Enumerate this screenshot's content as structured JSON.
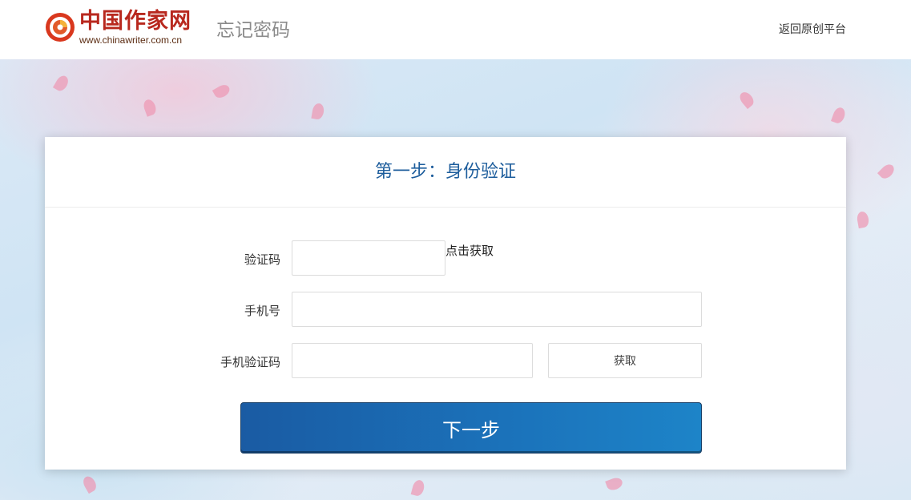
{
  "header": {
    "logo_text": "中国作家网",
    "logo_url": "www.chinawriter.com.cn",
    "page_heading": "忘记密码",
    "return_link": "返回原创平台"
  },
  "card": {
    "title": "第一步：身份验证",
    "fields": {
      "captcha": {
        "label": "验证码",
        "value": "",
        "get_link": "点击获取"
      },
      "phone": {
        "label": "手机号",
        "value": ""
      },
      "sms_code": {
        "label": "手机验证码",
        "value": "",
        "button_label": "获取"
      }
    },
    "next_button": "下一步"
  },
  "colors": {
    "title_blue": "#1d5d9c",
    "button_blue": "#1a5ba3",
    "logo_red": "#b8281e"
  },
  "icons": [
    "logo-emblem-icon"
  ]
}
